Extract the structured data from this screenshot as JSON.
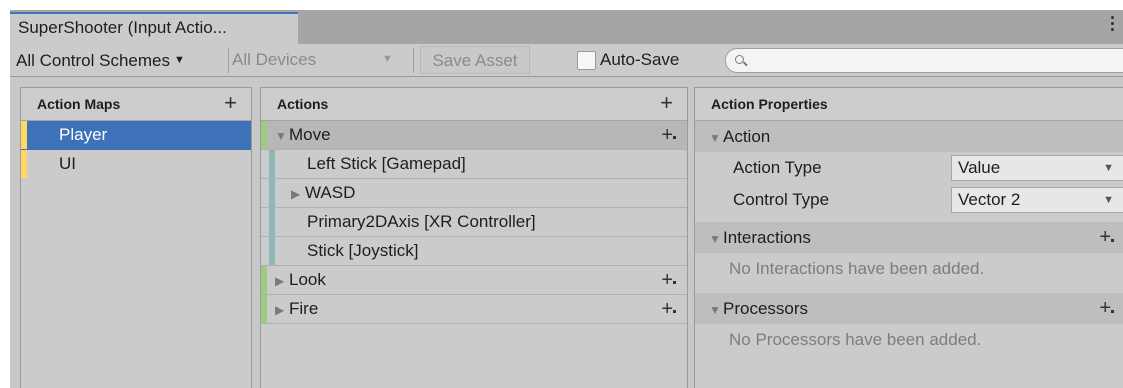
{
  "window": {
    "tab_title": "SuperShooter (Input Actio..."
  },
  "toolbar": {
    "control_scheme": "All Control Schemes",
    "devices": "All Devices",
    "save_asset": "Save Asset",
    "auto_save_label": "Auto-Save",
    "auto_save_checked": false,
    "search_value": ""
  },
  "action_maps": {
    "title": "Action Maps",
    "items": [
      {
        "label": "Player",
        "selected": true
      },
      {
        "label": "UI",
        "selected": false
      }
    ]
  },
  "actions": {
    "title": "Actions",
    "items": [
      {
        "label": "Move",
        "kind": "action",
        "expanded": true
      },
      {
        "label": "Left Stick [Gamepad]",
        "kind": "binding"
      },
      {
        "label": "WASD",
        "kind": "composite",
        "expanded": false
      },
      {
        "label": "Primary2DAxis [XR Controller]",
        "kind": "binding"
      },
      {
        "label": "Stick [Joystick]",
        "kind": "binding"
      },
      {
        "label": "Look",
        "kind": "action",
        "expanded": false
      },
      {
        "label": "Fire",
        "kind": "action",
        "expanded": false
      }
    ]
  },
  "properties": {
    "title": "Action Properties",
    "action_section": "Action",
    "action_type_label": "Action Type",
    "action_type_value": "Value",
    "control_type_label": "Control Type",
    "control_type_value": "Vector 2",
    "interactions_section": "Interactions",
    "interactions_empty": "No Interactions have been added.",
    "processors_section": "Processors",
    "processors_empty": "No Processors have been added."
  },
  "colors": {
    "selection": "#3e72b8",
    "tab_accent": "#3a79bb",
    "map_bar": "#ffd964",
    "action_bar": "#9ccc82",
    "binding_bar": "#8cb9b8"
  }
}
